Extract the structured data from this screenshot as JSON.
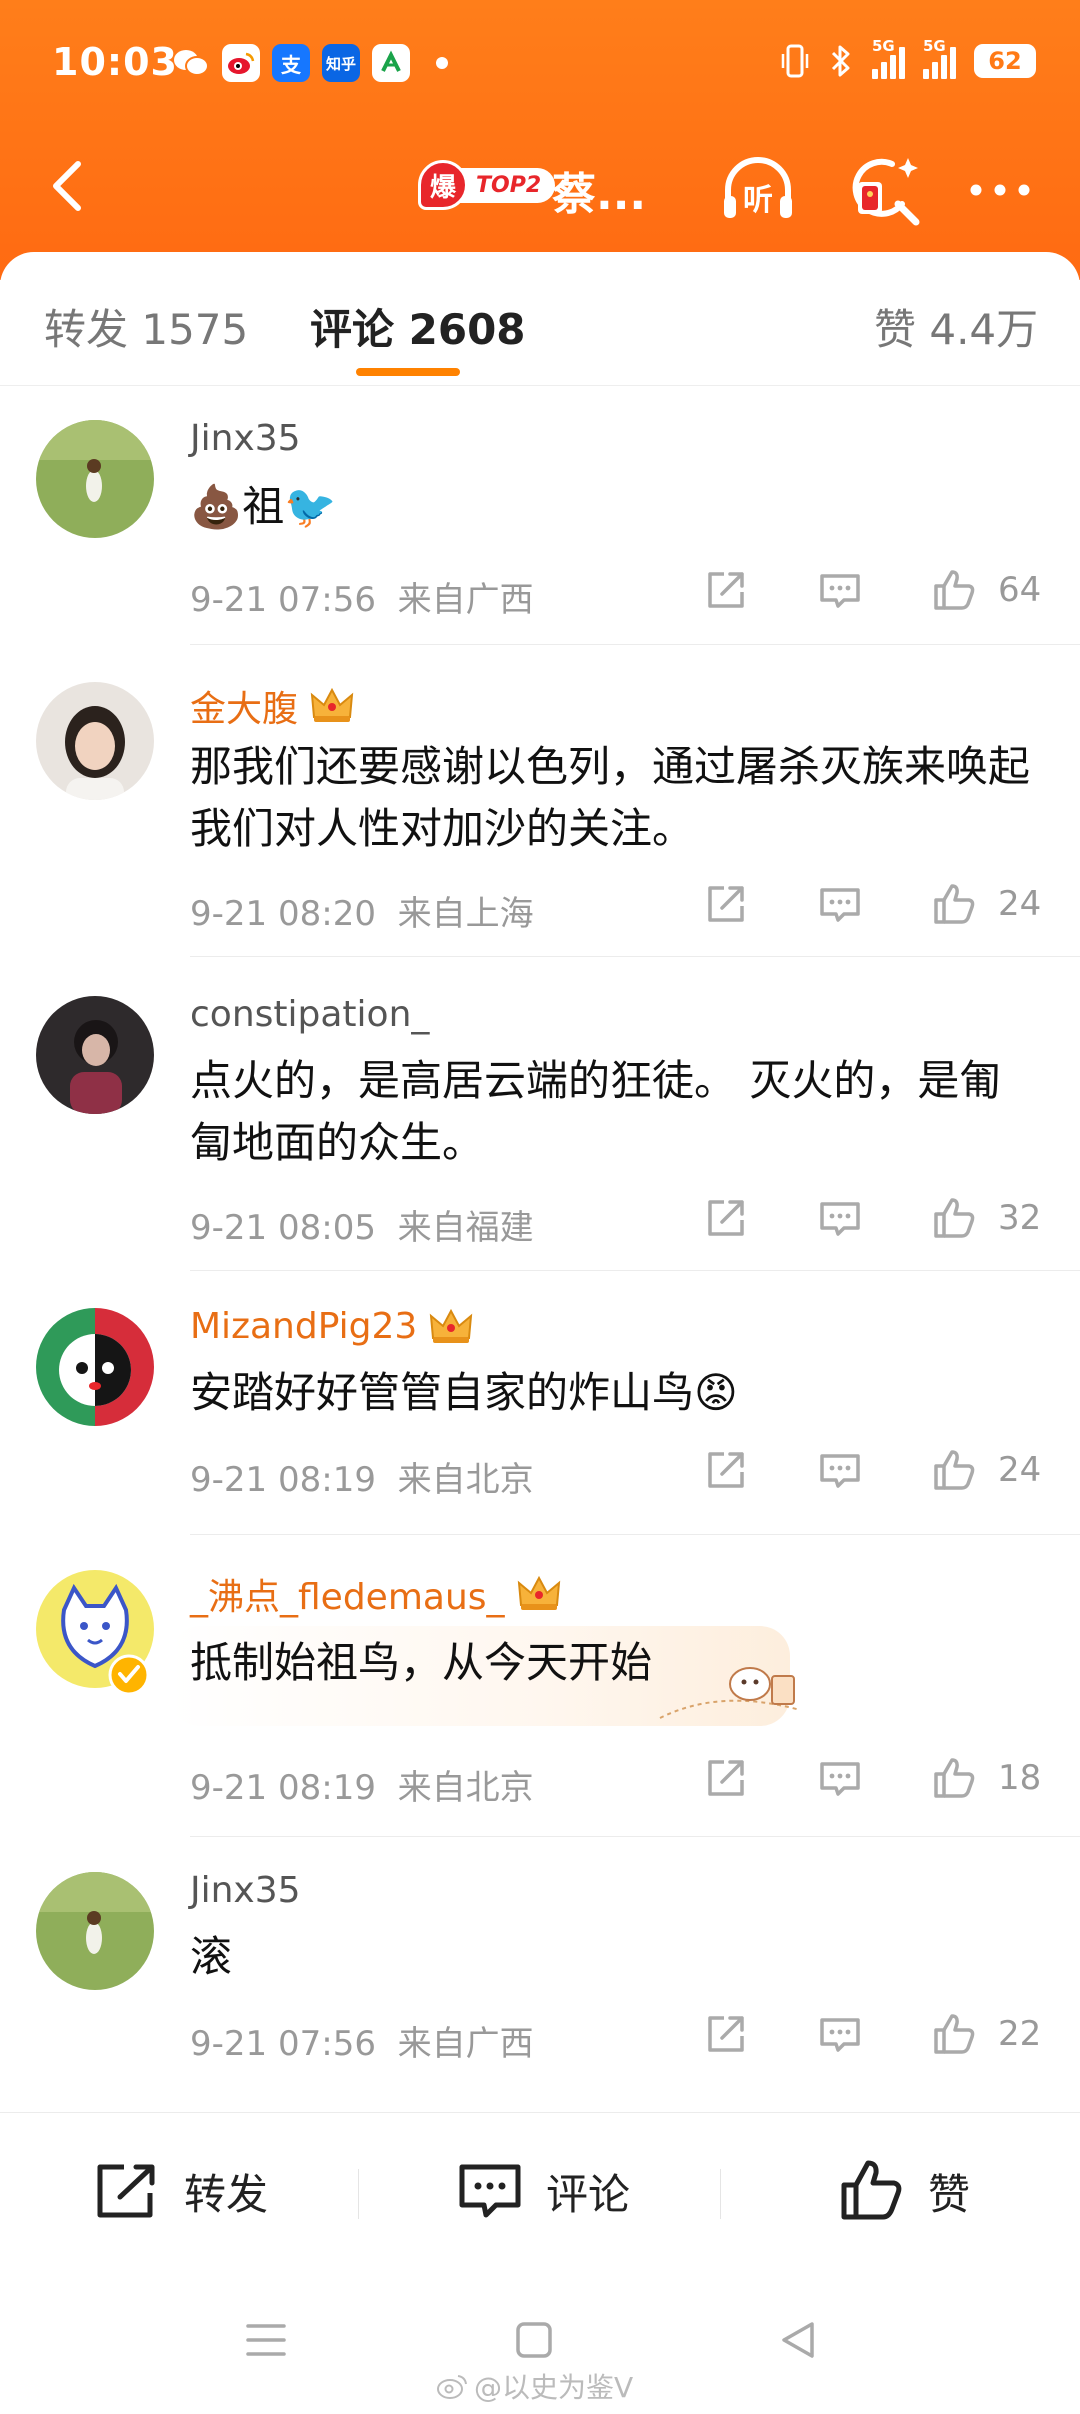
{
  "status_bar": {
    "time": "10:03",
    "apps": [
      "wechat",
      "weibo",
      "支",
      "知乎",
      "bank"
    ],
    "signal_label_1": "5G",
    "signal_label_2": "5G",
    "battery": "62"
  },
  "nav": {
    "hot_badge": "爆",
    "hot_rank": "TOP2",
    "title": "蔡...",
    "listen_label": "听"
  },
  "tabs": {
    "repost": "转发 1575",
    "comments": "评论 2608",
    "likes": "赞 4.4万"
  },
  "comments": [
    {
      "user": "Jinx35",
      "vip": false,
      "text": "💩祖🐦",
      "time": "9-21 07:56",
      "location": "来自广西",
      "likes": "64"
    },
    {
      "user": "金大腹",
      "vip": true,
      "text": "那我们还要感谢以色列，通过屠杀灭族来唤起我们对人性对加沙的关注。",
      "time": "9-21 08:20",
      "location": "来自上海",
      "likes": "24"
    },
    {
      "user": "constipation_",
      "vip": false,
      "text": "点火的，是高居云端的狂徒。 灭火的，是匍匐地面的众生。",
      "time": "9-21 08:05",
      "location": "来自福建",
      "likes": "32"
    },
    {
      "user": "MizandPig23",
      "vip": true,
      "text": "安踏好好管管自家的炸山鸟😡",
      "time": "9-21 08:19",
      "location": "来自北京",
      "likes": "24"
    },
    {
      "user": "_沸点_fledemaus_",
      "vip": true,
      "text": "抵制始祖鸟，从今天开始",
      "time": "9-21 08:19",
      "location": "来自北京",
      "likes": "18"
    },
    {
      "user": "Jinx35",
      "vip": false,
      "text": "滚",
      "time": "9-21 07:56",
      "location": "来自广西",
      "likes": "22"
    }
  ],
  "bottom_bar": {
    "repost": "转发",
    "comment": "评论",
    "like": "赞"
  },
  "watermark": "@以史为鉴V",
  "colors": {
    "brand_orange": "#ff7a16",
    "vip_name": "#e86e14",
    "tab_indicator": "#ff8200"
  }
}
